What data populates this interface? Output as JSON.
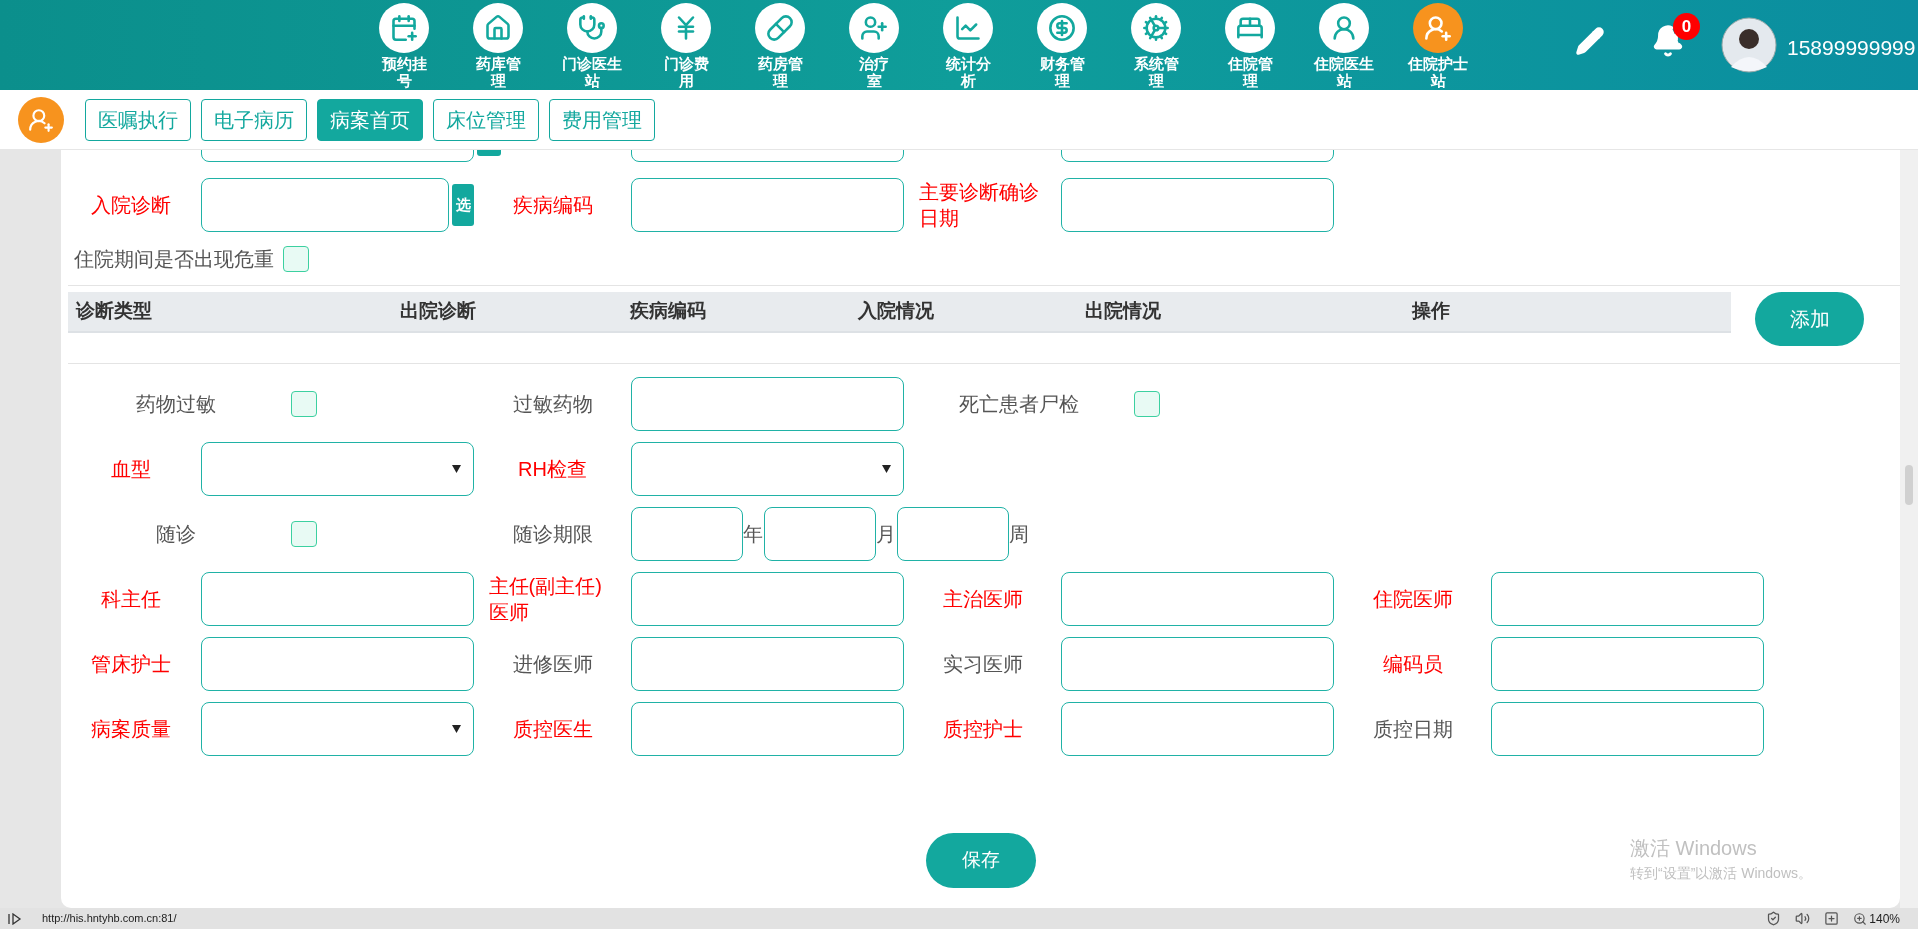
{
  "top_nav": {
    "items": [
      {
        "lines": [
          "预约挂",
          "号"
        ],
        "selected": false
      },
      {
        "lines": [
          "药库管",
          "理"
        ],
        "selected": false
      },
      {
        "lines": [
          "门诊医生",
          "站"
        ],
        "selected": false
      },
      {
        "lines": [
          "门诊费",
          "用"
        ],
        "selected": false
      },
      {
        "lines": [
          "药房管",
          "理"
        ],
        "selected": false
      },
      {
        "lines": [
          "治疗",
          "室"
        ],
        "selected": false
      },
      {
        "lines": [
          "统计分",
          "析"
        ],
        "selected": false
      },
      {
        "lines": [
          "财务管",
          "理"
        ],
        "selected": false
      },
      {
        "lines": [
          "系统管",
          "理"
        ],
        "selected": false
      },
      {
        "lines": [
          "住院管",
          "理"
        ],
        "selected": false
      },
      {
        "lines": [
          "住院医生",
          "站"
        ],
        "selected": false
      },
      {
        "lines": [
          "住院护士",
          "站"
        ],
        "selected": true
      }
    ],
    "notification_count": "0",
    "user": "15899999999"
  },
  "tabs": [
    {
      "label": "医嘱执行",
      "selected": false
    },
    {
      "label": "电子病历",
      "selected": false
    },
    {
      "label": "病案首页",
      "selected": true
    },
    {
      "label": "床位管理",
      "selected": false
    },
    {
      "label": "费用管理",
      "selected": false
    }
  ],
  "form": {
    "diagnosis_row": [
      {
        "label": "入院诊断",
        "required": true,
        "kind": "pick",
        "pick_button": "选"
      },
      {
        "label": "疾病编码",
        "required": true,
        "kind": "input"
      },
      {
        "label": "主要诊断确诊日期",
        "required": true,
        "kind": "input"
      }
    ],
    "critical_check": {
      "label": "住院期间是否出现危重",
      "checked": false
    },
    "diagnosis_table": {
      "columns": [
        "诊断类型",
        "出院诊断",
        "疾病编码",
        "入院情况",
        "出院情况",
        "操作"
      ],
      "add_button": "添加"
    },
    "rows": [
      [
        {
          "label": "药物过敏",
          "required": false,
          "kind": "checkbox",
          "checked": false
        },
        {
          "label": "过敏药物",
          "required": false,
          "kind": "input"
        },
        {
          "label": "死亡患者尸检",
          "required": false,
          "kind": "checkbox",
          "checked": false
        }
      ],
      [
        {
          "label": "血型",
          "required": true,
          "kind": "select"
        },
        {
          "label": "RH检查",
          "required": true,
          "kind": "select"
        }
      ],
      [
        {
          "label": "随诊",
          "required": false,
          "kind": "checkbox",
          "checked": false
        },
        {
          "label": "随诊期限",
          "required": false,
          "kind": "duration",
          "units": [
            "年",
            "月",
            "周"
          ]
        }
      ],
      [
        {
          "label": "科主任",
          "required": true,
          "kind": "input"
        },
        {
          "label": "主任(副主任)医师",
          "required": true,
          "kind": "input"
        },
        {
          "label": "主治医师",
          "required": true,
          "kind": "input"
        },
        {
          "label": "住院医师",
          "required": true,
          "kind": "input"
        }
      ],
      [
        {
          "label": "管床护士",
          "required": true,
          "kind": "input"
        },
        {
          "label": "进修医师",
          "required": false,
          "kind": "input"
        },
        {
          "label": "实习医师",
          "required": false,
          "kind": "input"
        },
        {
          "label": "编码员",
          "required": true,
          "kind": "input"
        }
      ],
      [
        {
          "label": "病案质量",
          "required": true,
          "kind": "select"
        },
        {
          "label": "质控医生",
          "required": true,
          "kind": "input"
        },
        {
          "label": "质控护士",
          "required": true,
          "kind": "input"
        },
        {
          "label": "质控日期",
          "required": false,
          "kind": "input"
        }
      ]
    ],
    "save_button": "保存"
  },
  "windows_notice": {
    "title": "激活 Windows",
    "text": "转到“设置”以激活 Windows。"
  },
  "status_bar": {
    "url": "http://his.hntyhb.com.cn:81/",
    "zoom": "140%"
  }
}
